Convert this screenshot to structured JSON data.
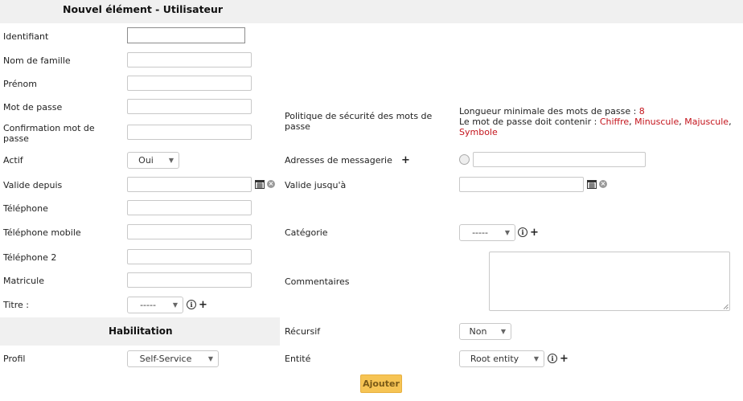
{
  "header": {
    "title": "Nouvel élément - Utilisateur"
  },
  "fields": {
    "identifiant": {
      "label": "Identifiant",
      "value": ""
    },
    "nom": {
      "label": "Nom de famille",
      "value": ""
    },
    "prenom": {
      "label": "Prénom",
      "value": ""
    },
    "mot_de_passe": {
      "label": "Mot de passe",
      "value": ""
    },
    "confirmation": {
      "label_line1": "Confirmation mot de",
      "label_line2": "passe",
      "value": ""
    },
    "actif": {
      "label": "Actif",
      "value": "Oui"
    },
    "valide_depuis": {
      "label": "Valide depuis",
      "value": ""
    },
    "telephone": {
      "label": "Téléphone",
      "value": ""
    },
    "telephone_mobile": {
      "label": "Téléphone mobile",
      "value": ""
    },
    "telephone_2": {
      "label": "Téléphone 2",
      "value": ""
    },
    "matricule": {
      "label": "Matricule",
      "value": ""
    },
    "titre": {
      "label": "Titre :",
      "value": "-----"
    },
    "politique": {
      "label_line1": "Politique de sécurité des mots de",
      "label_line2": "passe",
      "min_length_text": "Longueur minimale des mots de passe : ",
      "min_length_value": "8",
      "must_contain_text": "Le mot de passe doit contenir : ",
      "req_chiffre": "Chiffre",
      "req_minuscule": "Minuscule",
      "req_majuscule": "Majuscule",
      "req_symbole": "Symbole",
      "sep": ", "
    },
    "adresses": {
      "label": "Adresses de messagerie",
      "value": ""
    },
    "valide_jusqua": {
      "label": "Valide jusqu'à",
      "value": ""
    },
    "categorie": {
      "label": "Catégorie",
      "value": "-----"
    },
    "commentaires": {
      "label": "Commentaires",
      "value": ""
    }
  },
  "habilitation": {
    "title": "Habilitation",
    "profil": {
      "label": "Profil",
      "value": "Self-Service"
    },
    "recursif": {
      "label": "Récursif",
      "value": "Non"
    },
    "entite": {
      "label": "Entité",
      "value": "Root entity"
    }
  },
  "submit": {
    "label": "Ajouter"
  },
  "colors": {
    "accent_red": "#c4141c",
    "button_bg": "#f6c454",
    "band_bg": "#f0f0f0"
  }
}
